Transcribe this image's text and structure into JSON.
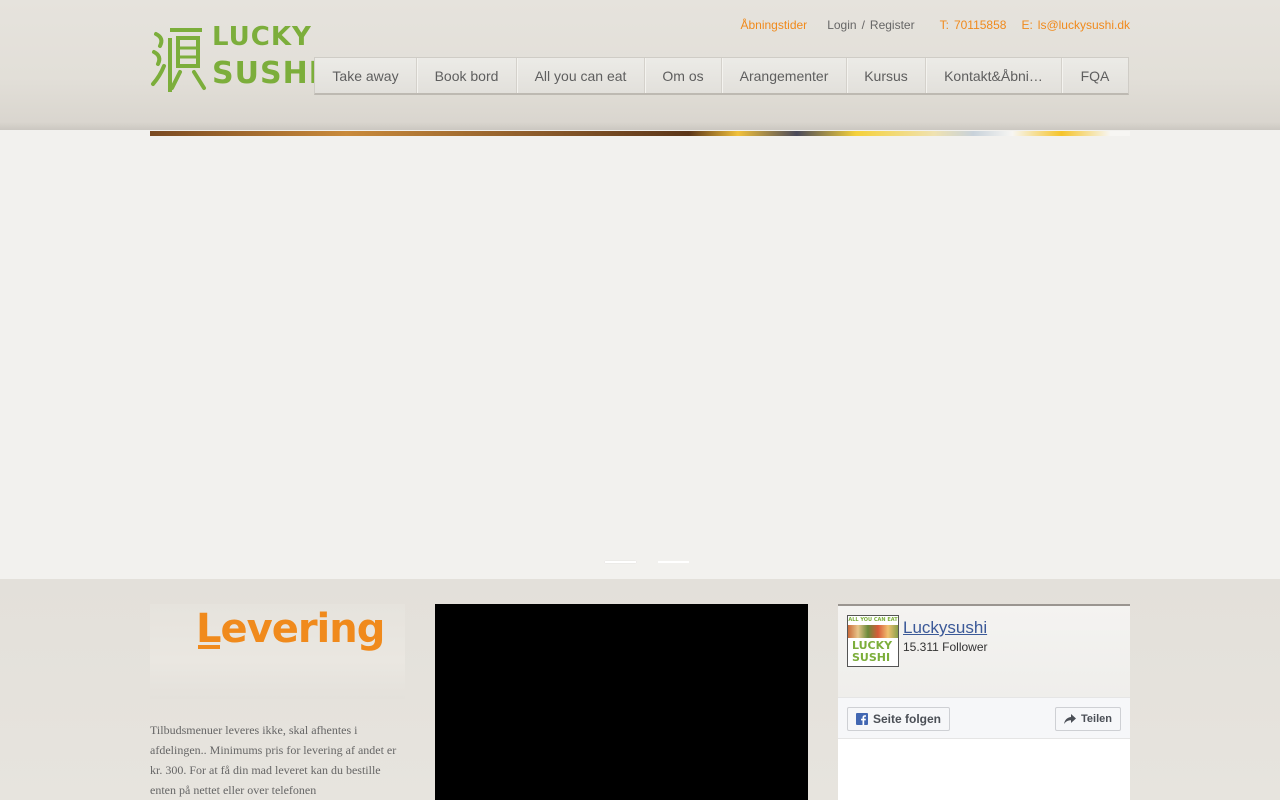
{
  "header": {
    "logo": {
      "line1": "LUCKY",
      "line2": "SUSHI"
    },
    "top_links": {
      "opening_hours": "Åbningstider",
      "login": "Login",
      "separator": "/",
      "register": "Register",
      "phone_label": "T:",
      "phone": "70115858",
      "email_label": "E:",
      "email": "ls@luckysushi.dk"
    },
    "nav": [
      {
        "label": "Take away"
      },
      {
        "label": "Book bord"
      },
      {
        "label": "All you can eat"
      },
      {
        "label": "Om os"
      },
      {
        "label": "Arangementer"
      },
      {
        "label": "Kursus"
      },
      {
        "label": "Kontakt&Åbni…"
      },
      {
        "label": "FQA"
      }
    ]
  },
  "slider": {
    "slides": 2,
    "active": 1
  },
  "levering": {
    "title": "Levering",
    "text": "Tilbudsmenuer leveres ikke, skal afhentes i afdelingen.. Minimums pris for levering af andet er kr. 300. For at få din mad leveret kan du bestille enten på nettet eller over telefonen"
  },
  "facebook": {
    "page_name": "Luckysushi",
    "followers": "15.311 Follower",
    "thumb_caption": "ALL YOU CAN EAT",
    "thumb_logo": "LUCKY SUSHI",
    "follow_label": "Seite folgen",
    "share_label": "Teilen"
  },
  "colors": {
    "brand_green": "#7cae3b",
    "brand_orange": "#f08a1c",
    "facebook_blue": "#3b5998"
  }
}
